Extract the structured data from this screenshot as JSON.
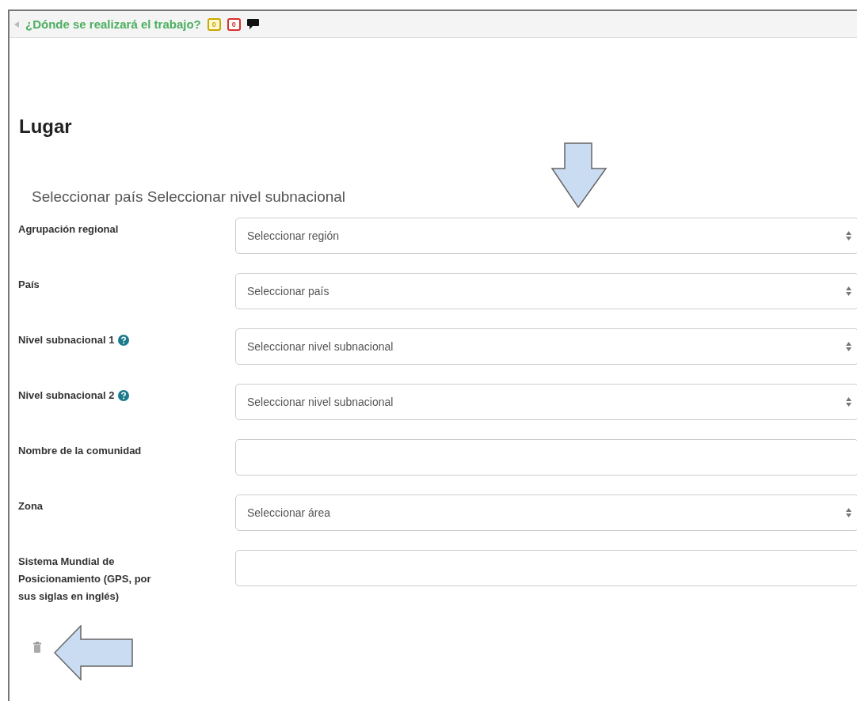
{
  "section": {
    "title": "¿Dónde se realizará el trabajo?",
    "expanded": true,
    "badges": [
      {
        "text": "0",
        "color": "#c9a800"
      },
      {
        "text": "0",
        "color": "#d9302c"
      }
    ]
  },
  "heading": "Lugar",
  "subtitle": "Seleccionar país Seleccionar nivel subnacional",
  "fields": [
    {
      "label": "Agrupación regional",
      "help": false,
      "kind": "select",
      "value": "Seleccionar región"
    },
    {
      "label": "País",
      "help": false,
      "kind": "select",
      "value": "Seleccionar país"
    },
    {
      "label": "Nivel subnacional 1",
      "help": true,
      "kind": "select",
      "value": "Seleccionar nivel subnacional"
    },
    {
      "label": "Nivel subnacional 2",
      "help": true,
      "kind": "select",
      "value": "Seleccionar nivel subnacional"
    },
    {
      "label": "Nombre de la comunidad",
      "help": false,
      "kind": "text"
    },
    {
      "label": "Zona",
      "help": false,
      "kind": "select",
      "value": "Seleccionar área"
    },
    {
      "label": "Sistema Mundial de Posicionamiento (GPS, por sus siglas en inglés)",
      "help": false,
      "kind": "text"
    }
  ]
}
